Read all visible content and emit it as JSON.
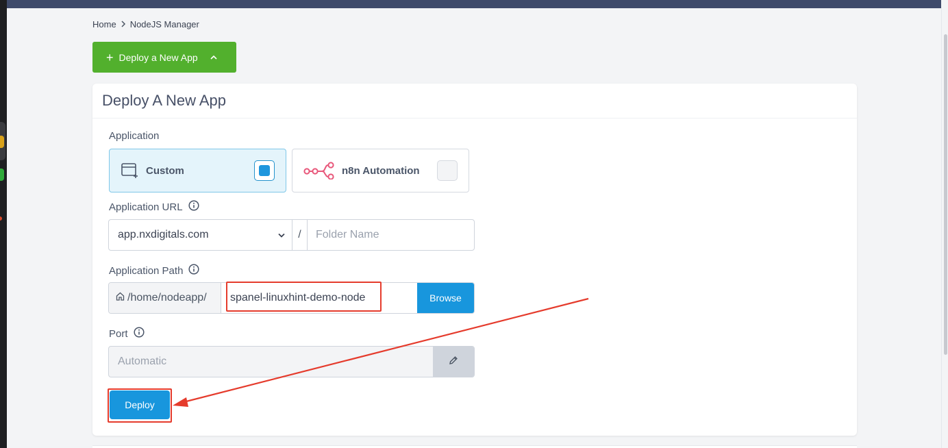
{
  "breadcrumb": {
    "home": "Home",
    "current": "NodeJS Manager"
  },
  "toolbar": {
    "deploy_toggle_label": "Deploy a New App"
  },
  "card": {
    "title": "Deploy A New App"
  },
  "application": {
    "label": "Application",
    "options": [
      {
        "label": "Custom",
        "selected": true
      },
      {
        "label": "n8n Automation",
        "selected": false
      }
    ]
  },
  "url": {
    "label": "Application URL",
    "domain": "app.nxdigitals.com",
    "slash": "/",
    "folder_placeholder": "Folder Name"
  },
  "path": {
    "label": "Application Path",
    "prefix": "/home/nodeapp/",
    "value": "spanel-linuxhint-demo-node",
    "browse_label": "Browse"
  },
  "port": {
    "label": "Port",
    "value": "Automatic"
  },
  "actions": {
    "deploy_label": "Deploy"
  },
  "colors": {
    "primary": "#1896dd",
    "success": "#52b02d",
    "annotation": "#e53b2c",
    "n8n_brand": "#e8577a"
  }
}
